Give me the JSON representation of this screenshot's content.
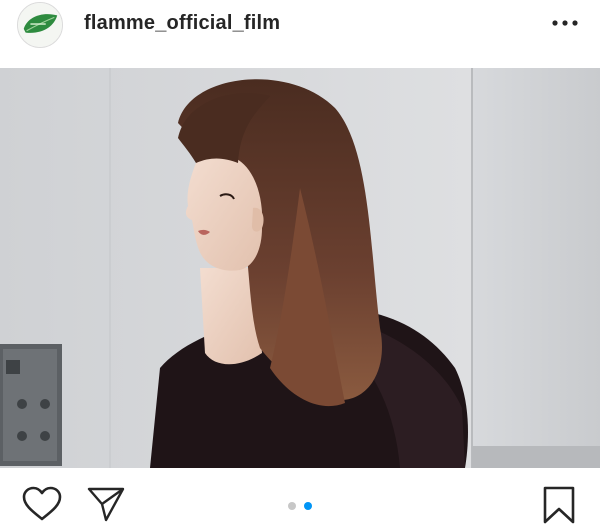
{
  "post": {
    "username": "flamme_official_film",
    "avatar_icon": "leaf-logo-icon",
    "more_icon": "more-horizontal-icon",
    "photo_description_icon": "portrait-photo",
    "carousel": {
      "count": 2,
      "active_index": 2
    }
  },
  "actions": {
    "like_icon": "heart-outline-icon",
    "share_icon": "paper-plane-icon",
    "save_icon": "bookmark-outline-icon"
  },
  "colors": {
    "text": "#262626",
    "carousel_active": "#0095f6",
    "carousel_inactive": "#c7c7c7",
    "avatar_leaf": "#2e8b3f"
  }
}
